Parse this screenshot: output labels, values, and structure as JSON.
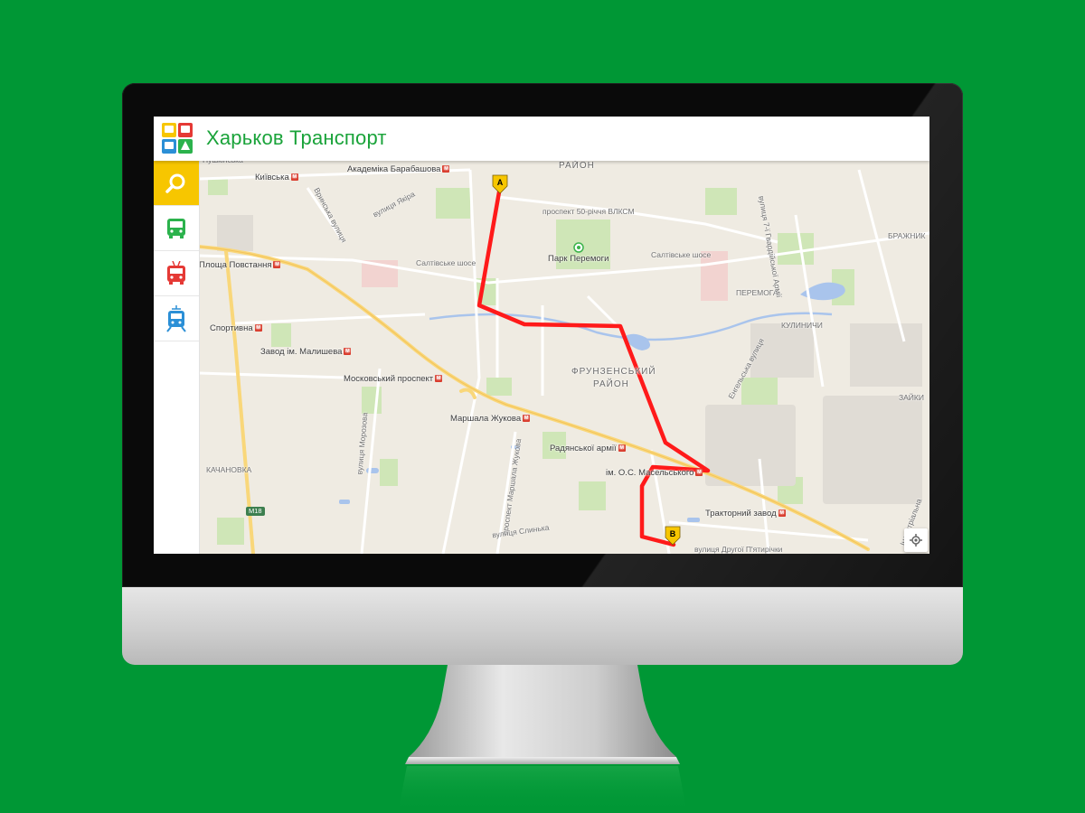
{
  "app": {
    "title": "Харьков Транспорт",
    "logo_icon": "transport-logo-icon",
    "accent_color": "#1aa33a",
    "background_color": "#009735"
  },
  "sidebar": {
    "items": [
      {
        "name": "search",
        "icon": "search-icon",
        "color": "#f7c600",
        "active": true
      },
      {
        "name": "bus",
        "icon": "bus-icon",
        "color": "#2bb24c"
      },
      {
        "name": "trolleybus",
        "icon": "trolleybus-icon",
        "color": "#e53935"
      },
      {
        "name": "tram",
        "icon": "tram-icon",
        "color": "#2b8fd6"
      }
    ]
  },
  "map": {
    "route_color": "#ff0000",
    "markers": {
      "start": "A",
      "end": "B"
    },
    "park_label": "Парк Перемоги",
    "metro_stations": [
      "Київська",
      "Академіка Барабашова",
      "Площа Повстання",
      "Спортивна",
      "Завод ім. Малишева",
      "Московський проспект",
      "Маршала Жукова",
      "Радянської армії",
      "ім. О.С. Масельського",
      "Тракторний завод"
    ],
    "districts": [
      "РАЙОН",
      "ФРУНЗЕНСЬКИЙ",
      "РАЙОН"
    ],
    "areas": [
      "КАЧАНОВКА",
      "ПЕРЕМОГА",
      "КУЛИНИЧИ",
      "БРАЖНИК",
      "ЗАЙКИ"
    ],
    "streets": [
      "вулиця Якіра",
      "Вринська вулиця",
      "проспект 50-річчя ВЛКСМ",
      "Салтівське шосе",
      "Салтівське шосе",
      "вулиця Морозова",
      "проспект Маршала Жукова",
      "вулиця Слинька",
      "вулиця Другої П'ятирічки",
      "вулиця 7-ї Гвардійської Армії",
      "Індустріальна",
      "Енгельська вулиця",
      "Пушкінська"
    ],
    "road_shields": [
      "M18"
    ],
    "locate_icon": "locate-me-icon"
  }
}
